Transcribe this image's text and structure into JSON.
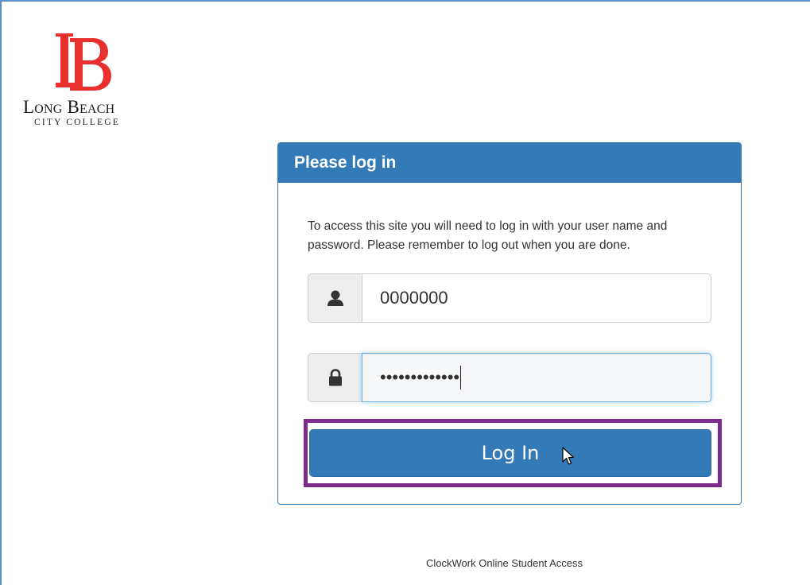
{
  "logo": {
    "name_line1": "Long Beach",
    "name_line2": "City College",
    "mark_letters": "LB",
    "brand_color": "#e8312f"
  },
  "panel": {
    "heading": "Please log in",
    "instructions": "To access this site you will need to log in with your user name and password. Please remember to log out when you are done.",
    "accent_color": "#337ab7"
  },
  "form": {
    "username_icon": "user-icon",
    "username_value": "0000000",
    "password_icon": "lock-icon",
    "password_value": "•••••••••••••",
    "submit_label": "Log In"
  },
  "highlight_color": "#7b2a8e",
  "footer": {
    "text": "ClockWork Online Student Access"
  }
}
